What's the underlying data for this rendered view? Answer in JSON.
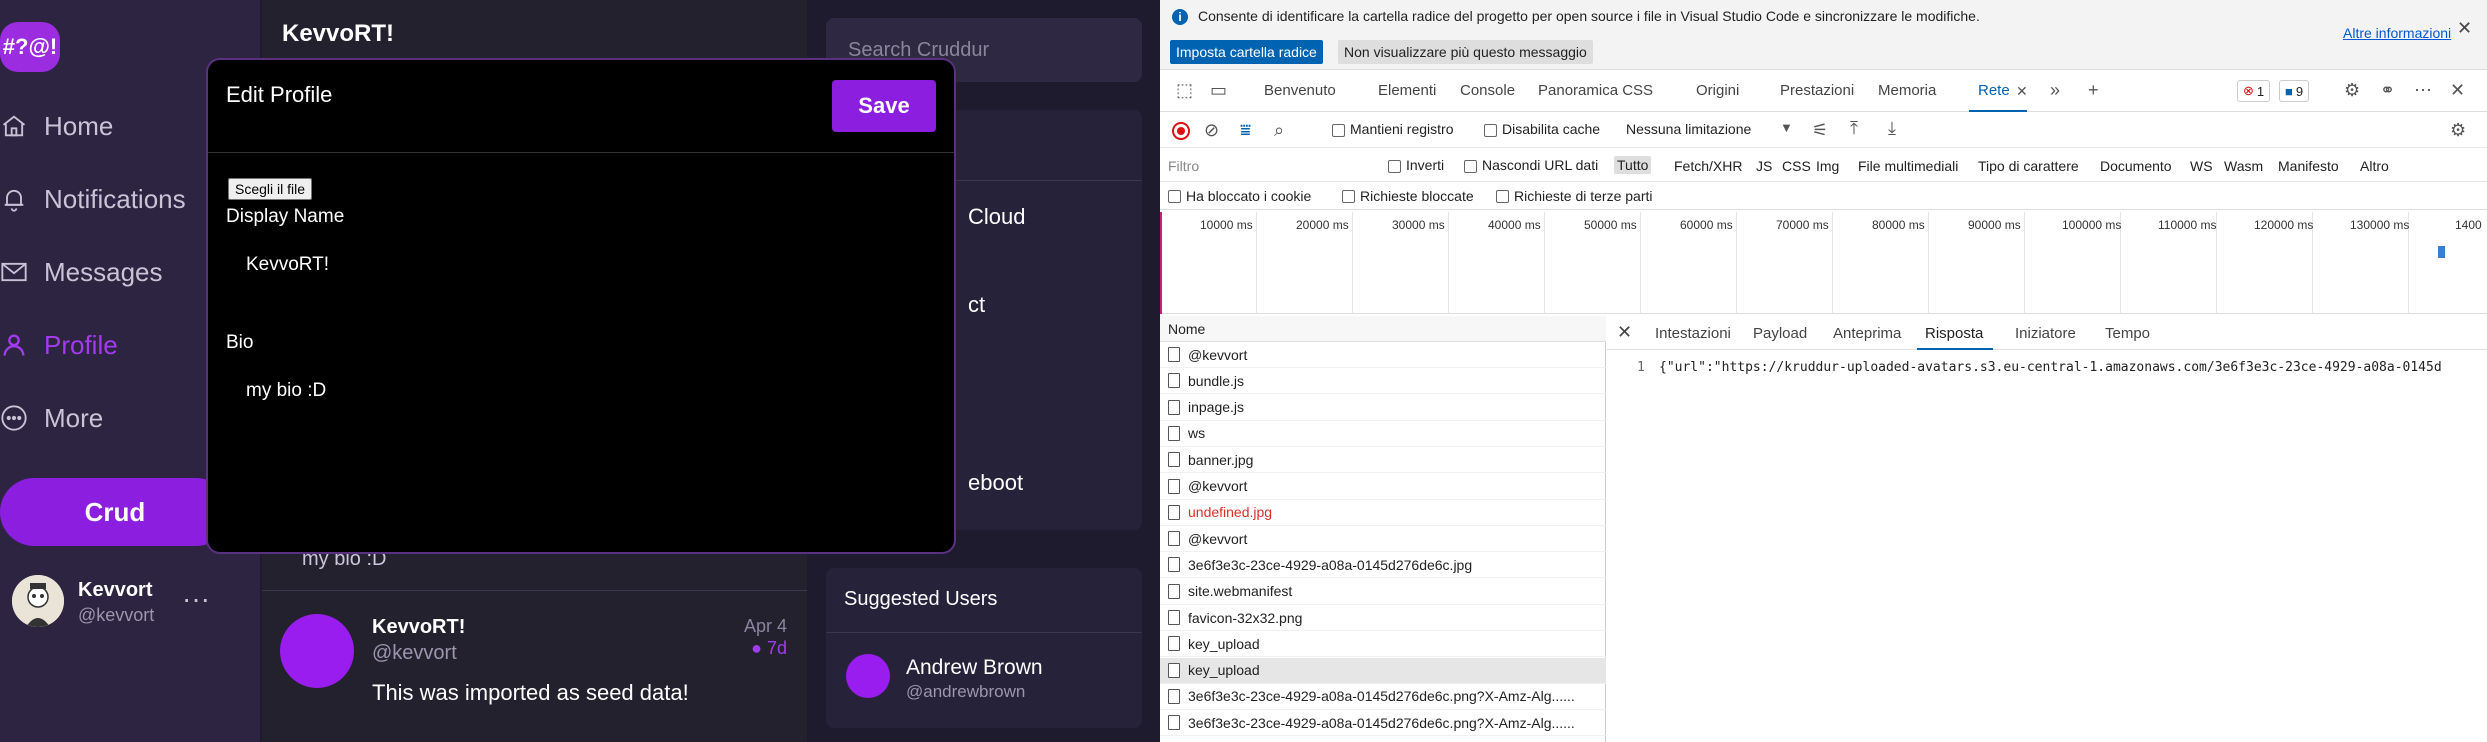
{
  "app": {
    "logo": "#?@!",
    "nav": [
      {
        "label": "Home",
        "icon": "home-icon"
      },
      {
        "label": "Notifications",
        "icon": "bell-icon"
      },
      {
        "label": "Messages",
        "icon": "mail-icon"
      },
      {
        "label": "Profile",
        "icon": "user-icon"
      },
      {
        "label": "More",
        "icon": "more-icon"
      }
    ],
    "crud_label": "Crud",
    "account": {
      "name": "Kevvort",
      "handle": "@kevvort",
      "more": "···"
    },
    "colors": {
      "accent": "#8c1ee0",
      "sidebar": "#2c2440",
      "bg": "#1f1b2e"
    }
  },
  "feed": {
    "title": "KevvoRT!",
    "bio": "my bio :D",
    "post": {
      "name": "KevvoRT!",
      "handle": "@kevvort",
      "date": "Apr 4",
      "ago": "7d",
      "body": "This was imported as seed data!"
    }
  },
  "right": {
    "search_placeholder": "Search Cruddur",
    "trends": [
      "Cloud",
      "ct",
      "eboot"
    ],
    "suggested_title": "Suggested Users",
    "suggested_user": {
      "name": "Andrew Brown",
      "handle": "@andrewbrown"
    }
  },
  "modal": {
    "title": "Edit Profile",
    "save_label": "Save",
    "file_button": "Scegli il file",
    "display_name_label": "Display Name",
    "display_name_value": "KevvoRT!",
    "bio_label": "Bio",
    "bio_value": "my bio :D"
  },
  "devtools": {
    "infobar": {
      "text": "Consente di identificare la cartella radice del progetto per open source i file in Visual Studio Code e sincronizzare le modifiche.",
      "link": "Altre informazioni",
      "primary": "Imposta cartella radice",
      "secondary": "Non visualizzare più questo messaggio"
    },
    "tabs": [
      "Benvenuto",
      "Elementi",
      "Console",
      "Panoramica CSS",
      "Origini",
      "Prestazioni",
      "Memoria",
      "Rete"
    ],
    "active_tab": "Rete",
    "errors": "1",
    "issues": "9",
    "toolbar": {
      "preserve_log": "Mantieni registro",
      "disable_cache": "Disabilita cache",
      "throttling": "Nessuna limitazione"
    },
    "filter": {
      "placeholder": "Filtro",
      "invert": "Inverti",
      "hide_data_urls": "Nascondi URL dati",
      "types": [
        "Tutto",
        "Fetch/XHR",
        "JS",
        "CSS",
        "Img",
        "File multimediali",
        "Tipo di carattere",
        "Documento",
        "WS",
        "Wasm",
        "Manifesto",
        "Altro"
      ]
    },
    "cookie_filters": [
      "Ha bloccato i cookie",
      "Richieste bloccate",
      "Richieste di terze parti"
    ],
    "timeline_ticks": [
      "10000 ms",
      "20000 ms",
      "30000 ms",
      "40000 ms",
      "50000 ms",
      "60000 ms",
      "70000 ms",
      "80000 ms",
      "90000 ms",
      "100000 ms",
      "110000 ms",
      "120000 ms",
      "130000 ms",
      "1400"
    ],
    "name_header": "Nome",
    "requests": [
      {
        "name": "@kevvort",
        "err": false,
        "sel": false
      },
      {
        "name": "bundle.js",
        "err": false,
        "sel": false
      },
      {
        "name": "inpage.js",
        "err": false,
        "sel": false
      },
      {
        "name": "ws",
        "err": false,
        "sel": false
      },
      {
        "name": "banner.jpg",
        "err": false,
        "sel": false
      },
      {
        "name": "@kevvort",
        "err": false,
        "sel": false
      },
      {
        "name": "undefined.jpg",
        "err": true,
        "sel": false
      },
      {
        "name": "@kevvort",
        "err": false,
        "sel": false
      },
      {
        "name": "3e6f3e3c-23ce-4929-a08a-0145d276de6c.jpg",
        "err": false,
        "sel": false
      },
      {
        "name": "site.webmanifest",
        "err": false,
        "sel": false
      },
      {
        "name": "favicon-32x32.png",
        "err": false,
        "sel": false
      },
      {
        "name": "key_upload",
        "err": false,
        "sel": false
      },
      {
        "name": "key_upload",
        "err": false,
        "sel": true
      },
      {
        "name": "3e6f3e3c-23ce-4929-a08a-0145d276de6c.png?X-Amz-Alg......",
        "err": false,
        "sel": false
      },
      {
        "name": "3e6f3e3c-23ce-4929-a08a-0145d276de6c.png?X-Amz-Alg......",
        "err": false,
        "sel": false
      }
    ],
    "detail_tabs": [
      "Intestazioni",
      "Payload",
      "Anteprima",
      "Risposta",
      "Iniziatore",
      "Tempo"
    ],
    "active_detail_tab": "Risposta",
    "response_line_no": "1",
    "response_text": "{\"url\":\"https://kruddur-uploaded-avatars.s3.eu-central-1.amazonaws.com/3e6f3e3c-23ce-4929-a08a-0145d"
  }
}
